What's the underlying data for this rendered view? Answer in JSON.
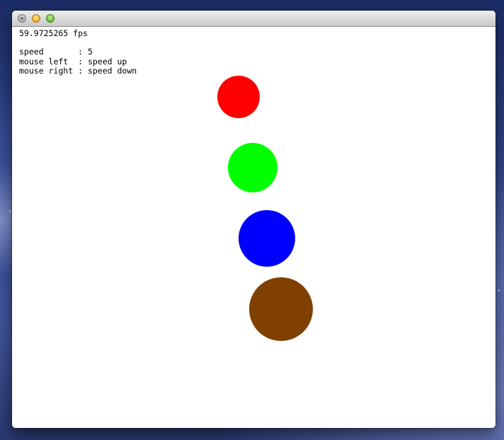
{
  "hud": {
    "fps_text": "59.9725265 fps",
    "rows": [
      {
        "key": "speed       ",
        "sep": ": ",
        "value": "5"
      },
      {
        "key": "mouse left  ",
        "sep": ": ",
        "value": "speed up"
      },
      {
        "key": "mouse right ",
        "sep": ": ",
        "value": "speed down"
      }
    ]
  },
  "balls": [
    {
      "name": "red",
      "color": "#ff0000"
    },
    {
      "name": "green",
      "color": "#00ff00"
    },
    {
      "name": "blue",
      "color": "#0000ff"
    },
    {
      "name": "brown",
      "color": "#804000"
    }
  ],
  "colors": {
    "background": "#ffffff",
    "text": "#000000"
  }
}
